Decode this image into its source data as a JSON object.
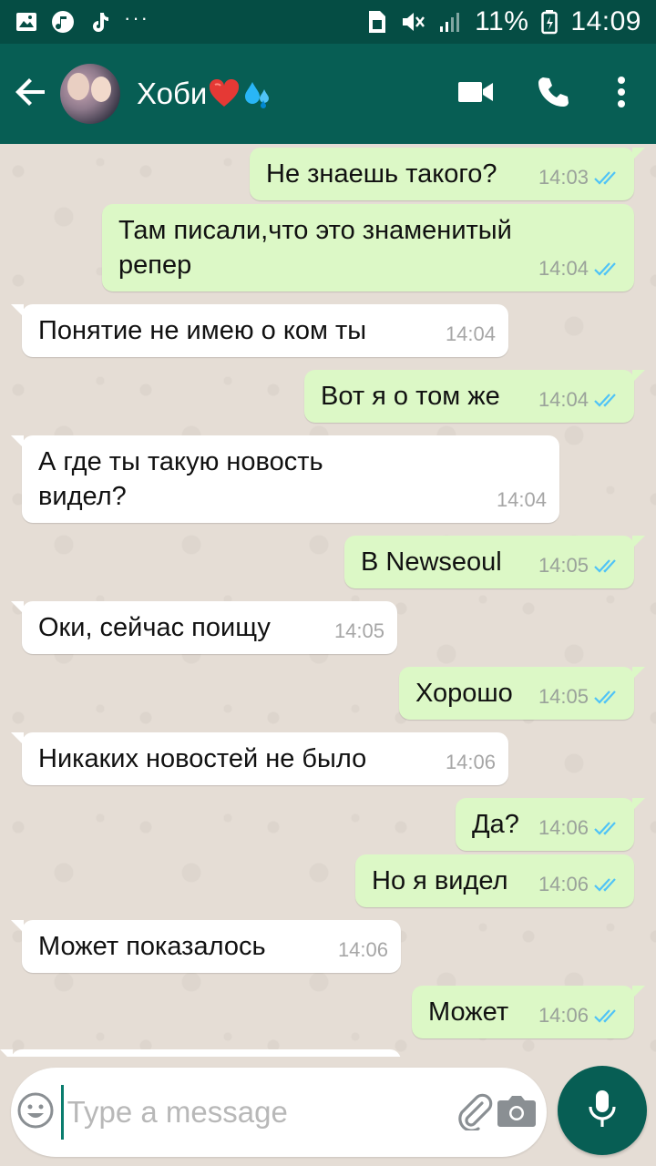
{
  "status_bar": {
    "battery_percent": "11%",
    "time": "14:09",
    "more_indicator": "···",
    "icons": [
      "gallery-icon",
      "music-icon",
      "tiktok-icon",
      "sim-icon",
      "mute-icon",
      "signal-icon",
      "battery-icon"
    ]
  },
  "header": {
    "contact_name": "Хоби",
    "emoji_heart": "❤️",
    "emoji_sweat": "💦",
    "icons": [
      "back-arrow-icon",
      "video-call-icon",
      "phone-icon",
      "more-vert-icon"
    ]
  },
  "messages": [
    {
      "dir": "out",
      "text": "Не знаешь такого?",
      "time": "14:03",
      "read": true
    },
    {
      "dir": "out",
      "text": "Там писали,что это знаменитый репер",
      "time": "14:04",
      "read": true
    },
    {
      "dir": "in",
      "text": "Понятие не имею о ком ты",
      "time": "14:04"
    },
    {
      "dir": "out",
      "text": "Вот я о том же",
      "time": "14:04",
      "read": true
    },
    {
      "dir": "in",
      "text": "А где ты такую новость видел?",
      "time": "14:04"
    },
    {
      "dir": "out",
      "text": "В Newseoul",
      "time": "14:05",
      "read": true
    },
    {
      "dir": "in",
      "text": "Оки, сейчас поищу",
      "time": "14:05"
    },
    {
      "dir": "out",
      "text": "Хорошо",
      "time": "14:05",
      "read": true
    },
    {
      "dir": "in",
      "text": "Никаких новостей не было",
      "time": "14:06"
    },
    {
      "dir": "out",
      "text": "Да?",
      "time": "14:06",
      "read": true
    },
    {
      "dir": "out",
      "text": "Но я видел",
      "time": "14:06",
      "read": true
    },
    {
      "dir": "in",
      "text": "Может показалось",
      "time": "14:06"
    },
    {
      "dir": "out",
      "text": "Может",
      "time": "14:06",
      "read": true
    }
  ],
  "composer": {
    "placeholder": "Type a message",
    "value": ""
  },
  "colors": {
    "status_bar": "#054d44",
    "app_bar": "#075e54",
    "chat_background": "#e5ddd5",
    "outgoing_bubble": "#dcf8c6",
    "incoming_bubble": "#ffffff",
    "read_ticks": "#4fc3f7",
    "mic_button": "#075e54"
  }
}
